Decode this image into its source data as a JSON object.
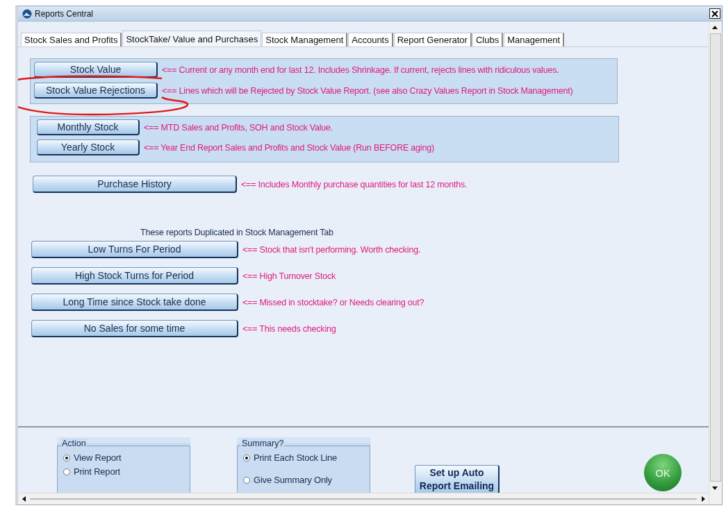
{
  "window": {
    "title": "Reports Central"
  },
  "tabs": [
    {
      "label": "Stock Sales and Profits",
      "selected": false
    },
    {
      "label": "StockTake/ Value and Purchases",
      "selected": true
    },
    {
      "label": "Stock Management",
      "selected": false
    },
    {
      "label": "Accounts",
      "selected": false
    },
    {
      "label": "Report Generator",
      "selected": false
    },
    {
      "label": "Clubs",
      "selected": false
    },
    {
      "label": "Management",
      "selected": false
    }
  ],
  "sections": [
    {
      "kind": "group",
      "rows": [
        {
          "button": "Stock Value",
          "note": "<== Current or any month end for last 12.  Includes Shrinkage. If current, rejects lines with ridiculous values."
        },
        {
          "button": "Stock Value Rejections",
          "note": "<== Lines which will be Rejected by Stock Value Report. (see also Crazy Values Report in Stock Management)"
        }
      ]
    },
    {
      "kind": "group",
      "rows": [
        {
          "button": "Monthly Stock",
          "note": "<== MTD Sales and Profits, SOH and Stock Value."
        },
        {
          "button": "Yearly Stock",
          "note": "<== Year End Report Sales and Profits and Stock Value (Run BEFORE aging)"
        }
      ]
    },
    {
      "kind": "plain",
      "rows": [
        {
          "button": "Purchase History",
          "note": "<== Includes Monthly purchase quantities for last 12 months."
        }
      ]
    },
    {
      "kind": "plain",
      "heading": "These reports Duplicated in Stock Management Tab",
      "rows": [
        {
          "button": "Low Turns For Period",
          "note": "<== Stock that isn't performing. Worth checking."
        },
        {
          "button": "High Stock Turns for Period",
          "note": "<== High Turnover Stock"
        },
        {
          "button": "Long Time since Stock take done",
          "note": "<== Missed in stocktake? or Needs clearing out?"
        },
        {
          "button": "No Sales for some time",
          "note": "<== This needs checking"
        }
      ]
    }
  ],
  "action": {
    "title": "Action",
    "options": [
      {
        "label": "View Report",
        "selected": true
      },
      {
        "label": "Print Report",
        "selected": false
      }
    ]
  },
  "summary": {
    "title": "Summary?",
    "options": [
      {
        "label": "Print Each Stock Line",
        "selected": true
      },
      {
        "label": "Give Summary Only",
        "selected": false
      }
    ]
  },
  "email_button": "Set up Auto Report Emailing",
  "ok_button": "OK"
}
